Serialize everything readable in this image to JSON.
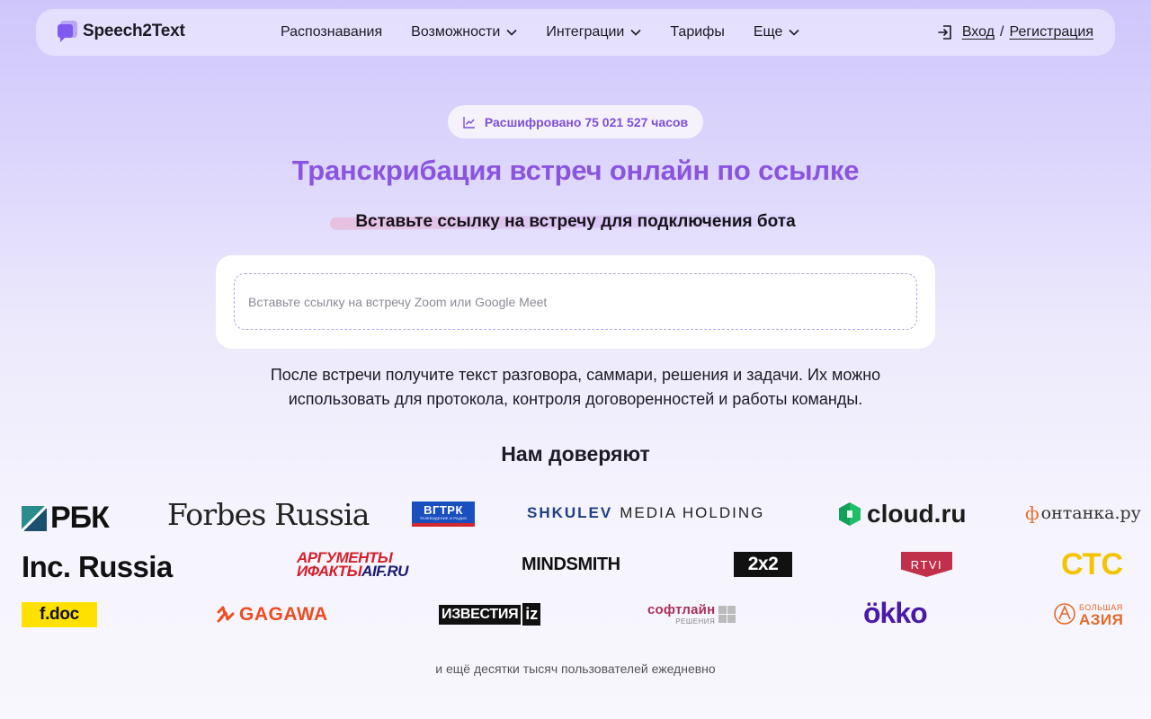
{
  "header": {
    "brand": "Speech2Text",
    "menu": [
      {
        "label": "Распознавания",
        "has_dropdown": false
      },
      {
        "label": "Возможности",
        "has_dropdown": true
      },
      {
        "label": "Интеграции",
        "has_dropdown": true
      },
      {
        "label": "Тарифы",
        "has_dropdown": false
      },
      {
        "label": "Еще",
        "has_dropdown": true
      }
    ],
    "login_label": "Вход",
    "separator": "/",
    "register_label": "Регистрация"
  },
  "hero": {
    "badge": "Расшифровано 75 021 527 часов",
    "title": "Транскрибация встреч онлайн по ссылке",
    "subtitle": "Вставьте ссылку на встречу для подключения бота",
    "input": {
      "placeholder": "Вставьте ссылку на встречу Zoom или Google Meet",
      "value": ""
    },
    "description_line1": "После встречи получите текст разговора, саммари, решения и задачи. Их можно",
    "description_line2": "использовать для протокола, контроля договоренностей и работы команды."
  },
  "trust": {
    "title": "Нам доверяют",
    "logos": {
      "rbk": "РБК",
      "forbes": "Forbes Russia",
      "vgtrk": "ВГТРК",
      "vgtrk_sub": "ТЕЛЕВИДЕНИЕ И РАДИО",
      "shkulev_bold": "SHKULEV",
      "shkulev_rest": "MEDIA HOLDING",
      "cloud": "cloud.ru",
      "fontanka": "онтанка.ру",
      "fontanka_f": "ф",
      "inc": "Inc. Russia",
      "aif_line1": "АРГУМЕНТЫ",
      "aif_line2": "ИФАКТЫ",
      "aif_site": "AIF.RU",
      "mindsmith": "MINDSMITH",
      "twobytwo": "2x2",
      "rtvi": "RTVI",
      "sts": "СТС",
      "fdoc": "f.doc",
      "gagawa": "GAGAWA",
      "izvestia": "ИЗВЕСТИЯ",
      "izvestia_iz": "iz",
      "softline": "софтлайн",
      "softline_sub": "РЕШЕНИЯ",
      "okko": "ökko",
      "azia_top": "БОЛЬШАЯ",
      "azia_bottom": "АЗИЯ"
    },
    "footnote": "и ещё десятки тысяч пользователей ежедневно"
  },
  "colors": {
    "accent": "#8a54e0",
    "badge_text": "#7c4fd8",
    "dashed_border": "#b8a2ec"
  }
}
